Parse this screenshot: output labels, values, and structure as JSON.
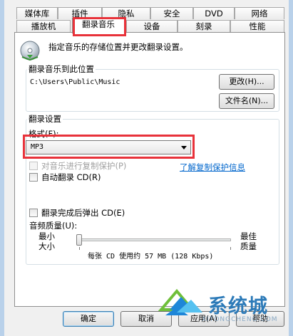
{
  "tabs_row1": [
    "媒体库",
    "插件",
    "隐私",
    "安全",
    "DVD",
    "网络"
  ],
  "tabs_row2": [
    "播放机",
    "翻录音乐",
    "设备",
    "刻录",
    "性能"
  ],
  "active_tab": "翻录音乐",
  "intro": "指定音乐的存储位置并更改翻录设置。",
  "rip_location": {
    "group_title": "翻录音乐到此位置",
    "path": "C:\\Users\\Public\\Music",
    "change_button": "更改(H)...",
    "filename_button": "文件名(N)..."
  },
  "rip_settings": {
    "group_title": "翻录设置",
    "format_label": "格式(F):",
    "format_value": "MP3",
    "copy_protect_label": "对音乐进行复制保护(P)",
    "copy_protect_link": "了解复制保护信息",
    "auto_rip_label": "自动翻录 CD(R)",
    "eject_label": "翻录完成后弹出 CD(E)",
    "quality_label": "音频质量(U):",
    "min_label_1": "最小",
    "min_label_2": "大小",
    "max_label_1": "最佳",
    "max_label_2": "质量",
    "quality_level": 0,
    "size_info": "每张 CD 使用约 57 MB (128 Kbps)"
  },
  "buttons": {
    "ok": "确定",
    "cancel": "取消",
    "apply": "应用(A)",
    "help": "帮助"
  },
  "watermark": {
    "text": "系统城",
    "url": "XITONGCHENG.COM"
  },
  "colors": {
    "highlight_red": "#e8323a",
    "link_blue": "#0066cc",
    "watermark_blue": "#2c7ab8"
  }
}
